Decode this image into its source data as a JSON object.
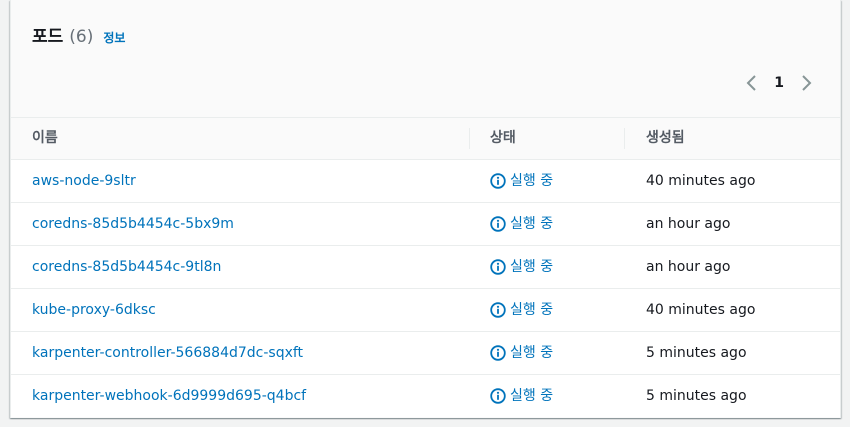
{
  "panel": {
    "title": "포드",
    "count": "(6)",
    "info_link": "정보"
  },
  "pagination": {
    "current_page": "1",
    "prev_icon": "chevron-left-icon",
    "next_icon": "chevron-right-icon"
  },
  "table": {
    "columns": [
      "이름",
      "상태",
      "생성됨"
    ],
    "rows": [
      {
        "name": "aws-node-9sltr",
        "status": "실행 중",
        "created": "40 minutes ago"
      },
      {
        "name": "coredns-85d5b4454c-5bx9m",
        "status": "실행 중",
        "created": "an hour ago"
      },
      {
        "name": "coredns-85d5b4454c-9tl8n",
        "status": "실행 중",
        "created": "an hour ago"
      },
      {
        "name": "kube-proxy-6dksc",
        "status": "실행 중",
        "created": "40 minutes ago"
      },
      {
        "name": "karpenter-controller-566884d7dc-sqxft",
        "status": "실행 중",
        "created": "5 minutes ago"
      },
      {
        "name": "karpenter-webhook-6d9999d695-q4bcf",
        "status": "실행 중",
        "created": "5 minutes ago"
      }
    ],
    "status_icon": "info-icon"
  },
  "colors": {
    "link": "#0073bb",
    "text": "#16191f",
    "header_text": "#545b64",
    "border": "#eaeded",
    "muted": "#687078"
  }
}
